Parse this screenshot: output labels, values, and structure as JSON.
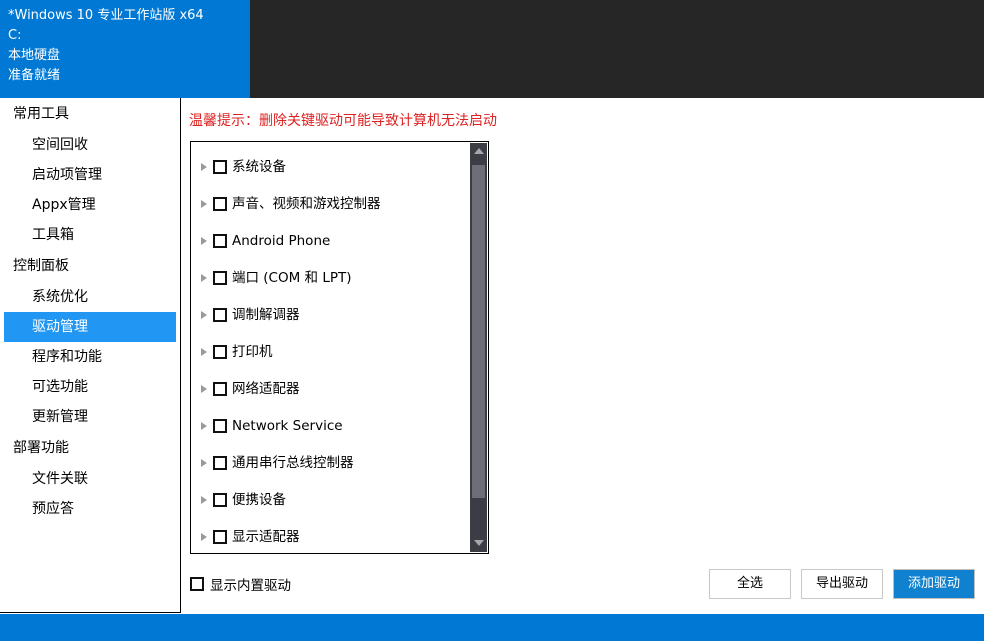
{
  "system_info": {
    "lines": [
      "*Windows 10 专业工作站版 x64",
      "C:",
      "本地硬盘",
      "准备就绪"
    ]
  },
  "colors": {
    "banner_blue": "#0078d4",
    "banner_dark": "#262626",
    "selection_blue": "#2196f3",
    "primary_button": "#0f81ce",
    "warning_red": "#dd2222",
    "status_strip": "#0078d4"
  },
  "sidebar": {
    "sections": [
      {
        "title": "常用工具",
        "items": [
          {
            "label": "空间回收",
            "active": false
          },
          {
            "label": "启动项管理",
            "active": false
          },
          {
            "label": "Appx管理",
            "active": false
          },
          {
            "label": "工具箱",
            "active": false
          }
        ]
      },
      {
        "title": "控制面板",
        "items": [
          {
            "label": "系统优化",
            "active": false
          },
          {
            "label": "驱动管理",
            "active": true
          },
          {
            "label": "程序和功能",
            "active": false
          },
          {
            "label": "可选功能",
            "active": false
          },
          {
            "label": "更新管理",
            "active": false
          }
        ]
      },
      {
        "title": "部署功能",
        "items": [
          {
            "label": "文件关联",
            "active": false
          },
          {
            "label": "预应答",
            "active": false
          }
        ]
      }
    ]
  },
  "content": {
    "warning": "温馨提示：删除关键驱动可能导致计算机无法启动",
    "tree": {
      "items": [
        {
          "label": "系统设备",
          "checked": false,
          "expandable": true
        },
        {
          "label": "声音、视频和游戏控制器",
          "checked": false,
          "expandable": true
        },
        {
          "label": "Android Phone",
          "checked": false,
          "expandable": true
        },
        {
          "label": "端口 (COM 和 LPT)",
          "checked": false,
          "expandable": true
        },
        {
          "label": "调制解调器",
          "checked": false,
          "expandable": true
        },
        {
          "label": "打印机",
          "checked": false,
          "expandable": true
        },
        {
          "label": "网络适配器",
          "checked": false,
          "expandable": true
        },
        {
          "label": "Network Service",
          "checked": false,
          "expandable": true
        },
        {
          "label": "通用串行总线控制器",
          "checked": false,
          "expandable": true
        },
        {
          "label": "便携设备",
          "checked": false,
          "expandable": true
        },
        {
          "label": "显示适配器",
          "checked": false,
          "expandable": true
        }
      ]
    },
    "show_builtin": {
      "label": "显示内置驱动",
      "checked": false
    },
    "buttons": [
      {
        "label": "全选",
        "primary": false
      },
      {
        "label": "导出驱动",
        "primary": false
      },
      {
        "label": "添加驱动",
        "primary": true
      }
    ]
  }
}
